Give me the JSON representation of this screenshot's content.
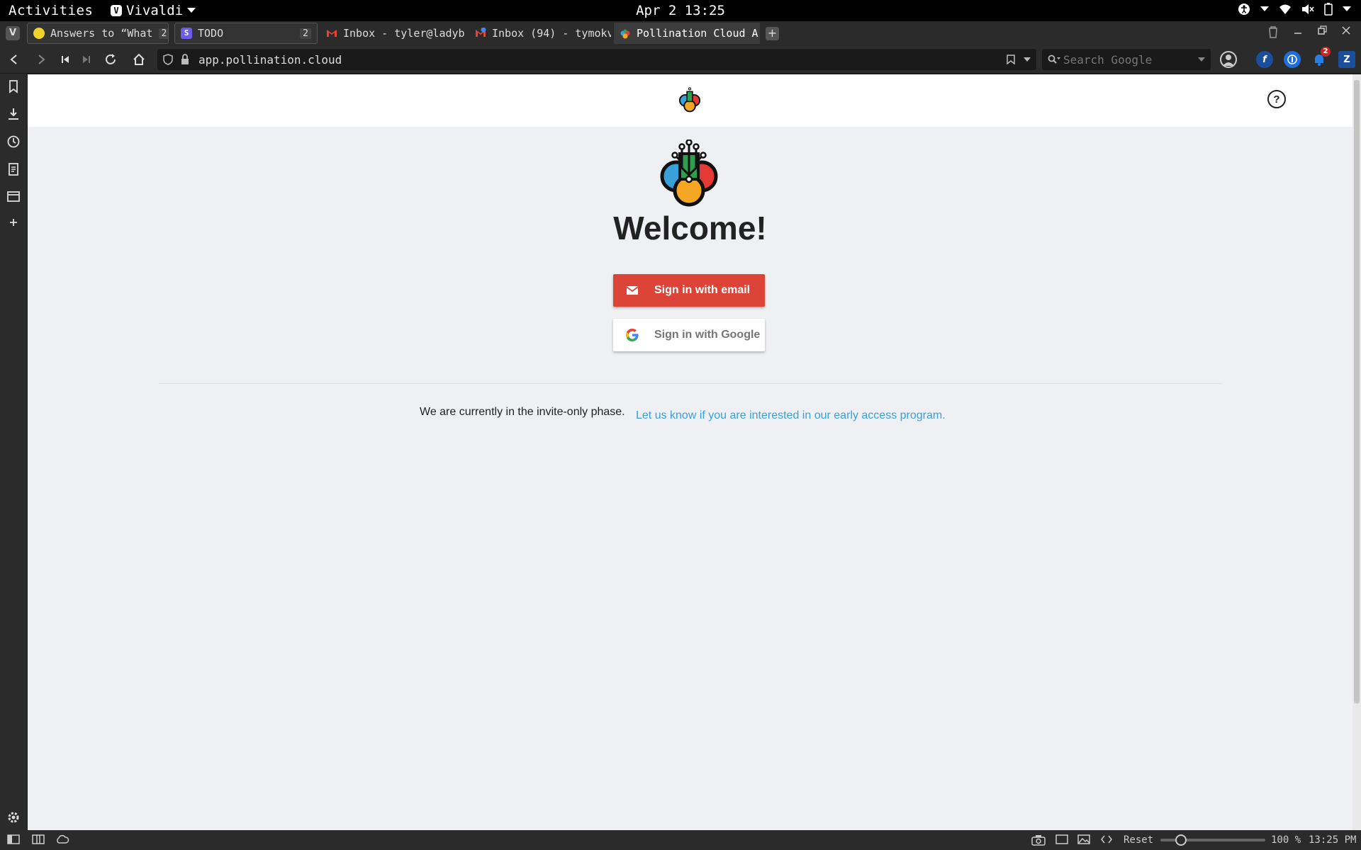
{
  "system": {
    "activities": "Activities",
    "app_name": "Vivaldi",
    "clock": "Apr 2  13:25"
  },
  "tabs": [
    {
      "title": "Answers to “What",
      "count": "2"
    },
    {
      "title": "TODO",
      "count": "2"
    },
    {
      "title": "Inbox - tyler@ladyb"
    },
    {
      "title": "Inbox (94) - tymokv"
    },
    {
      "title": "Pollination Cloud A"
    }
  ],
  "addressbar": {
    "url": "app.pollination.cloud",
    "search_placeholder": "Search Google"
  },
  "extensions": {
    "notification_badge": "2",
    "zotero_label": "Z"
  },
  "page": {
    "help_label": "?",
    "welcome": "Welcome!",
    "email_button": "Sign in with email",
    "google_button": "Sign in with Google",
    "invite_text": "We are currently in the invite-only phase.",
    "early_access_link": "Let us know if you are interested in our early access program."
  },
  "statusbar": {
    "reset": "Reset",
    "zoom": "100 %",
    "time": "13:25 PM"
  },
  "colors": {
    "email_button": "#db4437",
    "link": "#3aa0da",
    "page_background": "#eff0f4"
  }
}
